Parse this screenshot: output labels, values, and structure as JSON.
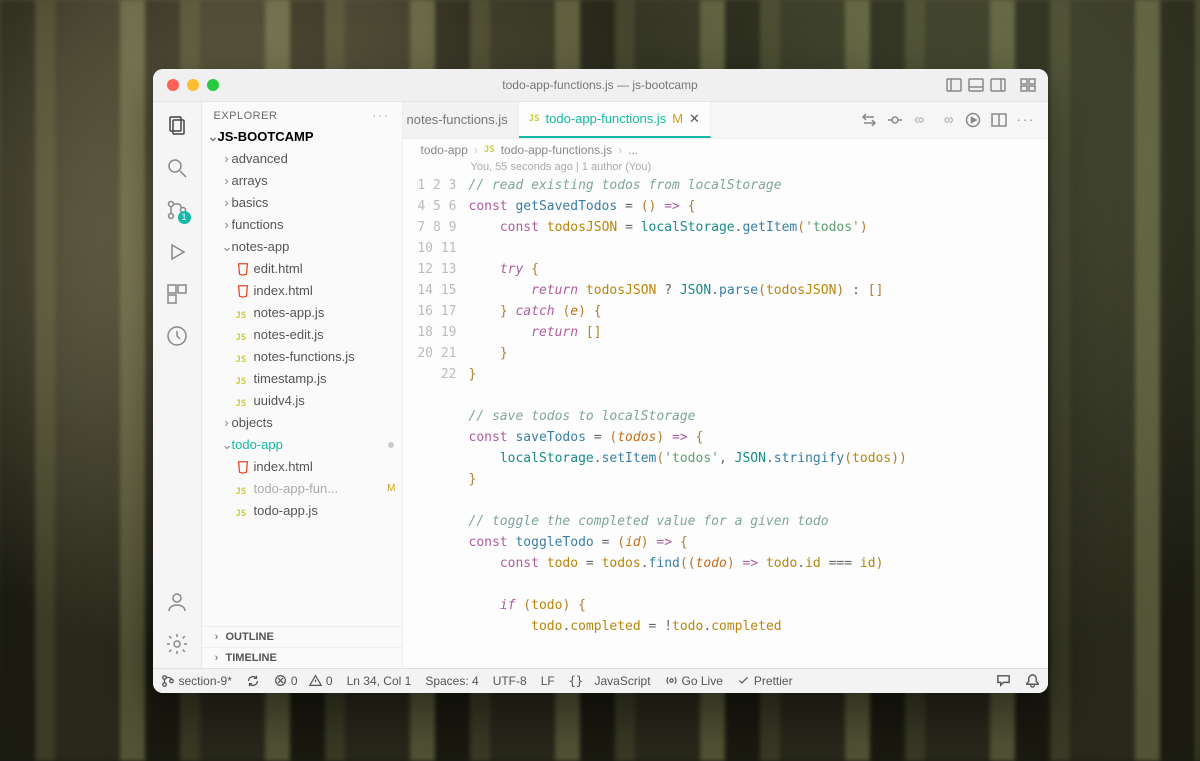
{
  "titlebar": {
    "title": "todo-app-functions.js — js-bootcamp"
  },
  "sidebar": {
    "header": "EXPLORER",
    "root": "JS-BOOTCAMP",
    "tree": [
      {
        "type": "folder",
        "name": "advanced",
        "open": false,
        "depth": 1
      },
      {
        "type": "folder",
        "name": "arrays",
        "open": false,
        "depth": 1
      },
      {
        "type": "folder",
        "name": "basics",
        "open": false,
        "depth": 1
      },
      {
        "type": "folder",
        "name": "functions",
        "open": false,
        "depth": 1
      },
      {
        "type": "folder",
        "name": "notes-app",
        "open": true,
        "depth": 1
      },
      {
        "type": "file",
        "name": "edit.html",
        "icon": "html",
        "depth": 2
      },
      {
        "type": "file",
        "name": "index.html",
        "icon": "html",
        "depth": 2
      },
      {
        "type": "file",
        "name": "notes-app.js",
        "icon": "js",
        "depth": 2
      },
      {
        "type": "file",
        "name": "notes-edit.js",
        "icon": "js",
        "depth": 2
      },
      {
        "type": "file",
        "name": "notes-functions.js",
        "icon": "js",
        "depth": 2
      },
      {
        "type": "file",
        "name": "timestamp.js",
        "icon": "js",
        "depth": 2
      },
      {
        "type": "file",
        "name": "uuidv4.js",
        "icon": "js",
        "depth": 2
      },
      {
        "type": "folder",
        "name": "objects",
        "open": false,
        "depth": 1
      },
      {
        "type": "folder",
        "name": "todo-app",
        "open": true,
        "depth": 1,
        "selected": true,
        "modified": true
      },
      {
        "type": "file",
        "name": "index.html",
        "icon": "html",
        "depth": 2
      },
      {
        "type": "file",
        "name": "todo-app-fun...",
        "icon": "js",
        "depth": 2,
        "dim": true,
        "m": "M"
      },
      {
        "type": "file",
        "name": "todo-app.js",
        "icon": "js",
        "depth": 2
      }
    ],
    "outline": "OUTLINE",
    "timeline": "TIMELINE"
  },
  "activitybar": {
    "badge": "1"
  },
  "tabs": {
    "items": [
      {
        "label": "notes-functions.js",
        "icon": "js",
        "active": false,
        "partial": true
      },
      {
        "label": "todo-app-functions.js",
        "icon": "js",
        "active": true,
        "status": "M",
        "close": true
      }
    ]
  },
  "breadcrumb": {
    "parts": [
      "todo-app",
      "todo-app-functions.js",
      "..."
    ]
  },
  "blame": "You, 55 seconds ago | 1 author (You)",
  "lines": {
    "start": 1,
    "end": 22
  },
  "statusbar": {
    "branch": "section-9*",
    "errors": "0",
    "warnings": "0",
    "cursor": "Ln 34, Col 1",
    "spaces": "Spaces: 4",
    "encoding": "UTF-8",
    "eol": "LF",
    "lang": "JavaScript",
    "golive": "Go Live",
    "prettier": "Prettier"
  }
}
